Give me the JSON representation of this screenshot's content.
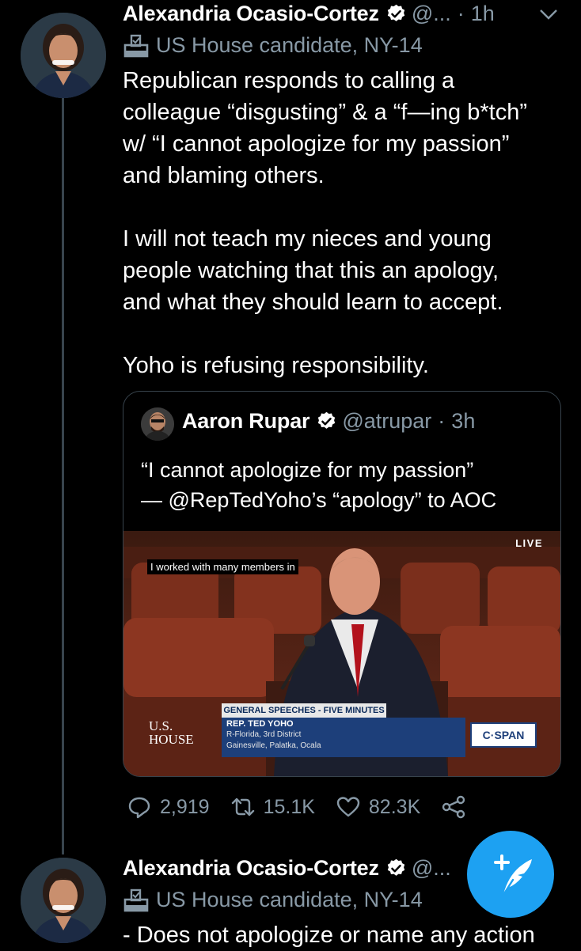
{
  "tweet1": {
    "name": "Alexandria Ocasio-Cortez",
    "handle": "@...",
    "time": "1h",
    "label": "US House candidate, NY-14",
    "text": "Republican responds to calling a\ncolleague “disgusting” & a “f—ing b*tch”\nw/ “I cannot apologize for my passion”\nand blaming others.\n\nI will not teach my nieces and young\npeople watching that this an apology,\nand what they should learn to accept.\n\nYoho is refusing responsibility."
  },
  "quote": {
    "name": "Aaron Rupar",
    "handle": "@atrupar",
    "time": "3h",
    "text": "“I cannot apologize for my passion”\n— @RepTedYoho’s “apology” to AOC",
    "video": {
      "live": "LIVE",
      "caption": "I worked with many members in",
      "lower_third_title": "GENERAL SPEECHES - FIVE MINUTES",
      "speaker": "REP. TED YOHO",
      "district": "R-Florida, 3rd District",
      "cities": "Gainesville, Palatka, Ocala",
      "house_logo_line1": "U.S.",
      "house_logo_line2": "HOUSE",
      "network": "C·SPAN"
    }
  },
  "actions": {
    "replies": "2,919",
    "retweets": "15.1K",
    "likes": "82.3K"
  },
  "tweet2": {
    "name": "Alexandria Ocasio-Cortez",
    "handle": "@...",
    "label": "US House candidate, NY-14",
    "text": "- Does not apologize or name any action"
  },
  "colors": {
    "background": "#000000",
    "secondary_text": "#8899a6",
    "accent": "#1da1f2",
    "border": "#38444d"
  }
}
